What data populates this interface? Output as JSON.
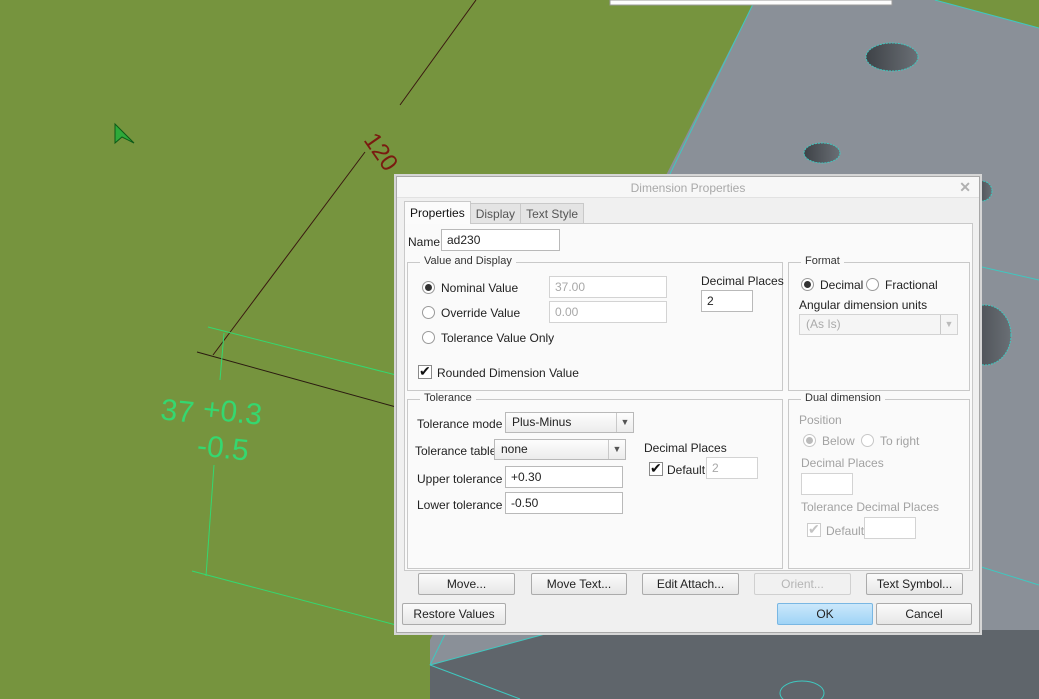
{
  "viewport": {
    "annotations": {
      "dim_120": "120",
      "dim_nominal": "37",
      "dim_upper": "+0.3",
      "dim_lower": "-0.5"
    },
    "colors": {
      "background_green": "#76943e",
      "part_surface": "#8a9098",
      "part_dark_face": "#5f656b",
      "edge_highlight": "#3fc8c0",
      "dimension_red": "#7a1a10",
      "dimension_green": "#34d870"
    }
  },
  "dialog": {
    "title": "Dimension Properties",
    "close_icon": "close-icon",
    "tabs": [
      {
        "label": "Properties",
        "active": true
      },
      {
        "label": "Display",
        "active": false
      },
      {
        "label": "Text Style",
        "active": false
      }
    ],
    "name_label": "Name",
    "name_value": "ad230",
    "value_display": {
      "legend": "Value and Display",
      "nominal_label": "Nominal Value",
      "nominal_value": "37.00",
      "override_label": "Override Value",
      "override_value": "0.00",
      "tolerance_only_label": "Tolerance Value Only",
      "selected": "Nominal Value",
      "decimal_places_label": "Decimal Places",
      "decimal_places_value": "2",
      "rounded_label": "Rounded Dimension Value",
      "rounded_checked": true
    },
    "format": {
      "legend": "Format",
      "decimal_label": "Decimal",
      "fractional_label": "Fractional",
      "selected": "Decimal",
      "angular_label": "Angular dimension units",
      "angular_value": "(As Is)"
    },
    "tolerance": {
      "legend": "Tolerance",
      "mode_label": "Tolerance mode",
      "mode_value": "Plus-Minus",
      "table_label": "Tolerance table",
      "table_value": "none",
      "upper_label": "Upper tolerance",
      "upper_value": "+0.30",
      "lower_label": "Lower tolerance",
      "lower_value": "-0.50",
      "decimal_places_label": "Decimal Places",
      "default_label": "Default",
      "default_checked": true,
      "decimal_places_value": "2"
    },
    "dual": {
      "legend": "Dual dimension",
      "position_label": "Position",
      "below_label": "Below",
      "to_right_label": "To right",
      "selected": "Below",
      "decimal_places_label": "Decimal Places",
      "decimal_places_value": "",
      "tol_decimal_label": "Tolerance Decimal Places",
      "default_label": "Default",
      "default_checked": true,
      "tol_decimal_value": ""
    },
    "buttons": {
      "move": "Move...",
      "move_text": "Move Text...",
      "edit_attach": "Edit Attach...",
      "orient": "Orient...",
      "text_symbol": "Text Symbol...",
      "restore": "Restore Values",
      "ok": "OK",
      "cancel": "Cancel"
    }
  }
}
